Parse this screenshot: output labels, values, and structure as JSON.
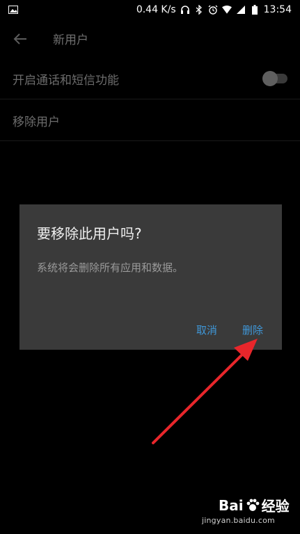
{
  "status_bar": {
    "speed": "0.44 K/s",
    "time": "13:54",
    "icons": [
      "image-icon",
      "headphones-icon",
      "bluetooth-icon",
      "alarm-icon",
      "wifi-icon",
      "signal-icon",
      "battery-icon"
    ]
  },
  "header": {
    "title": "新用户"
  },
  "settings": {
    "calls_sms_label": "开启通话和短信功能",
    "calls_sms_enabled": false,
    "remove_user_label": "移除用户"
  },
  "dialog": {
    "title": "要移除此用户吗?",
    "message": "系统将会删除所有应用和数据。",
    "cancel_label": "取消",
    "delete_label": "删除"
  },
  "watermark": {
    "logo_text": "Bai",
    "logo_suffix": "经验",
    "url": "jingyan.baidu.com"
  },
  "colors": {
    "background": "#000000",
    "dialog_bg": "#3a3a3a",
    "accent": "#3f97d8",
    "arrow": "#e8262b"
  }
}
